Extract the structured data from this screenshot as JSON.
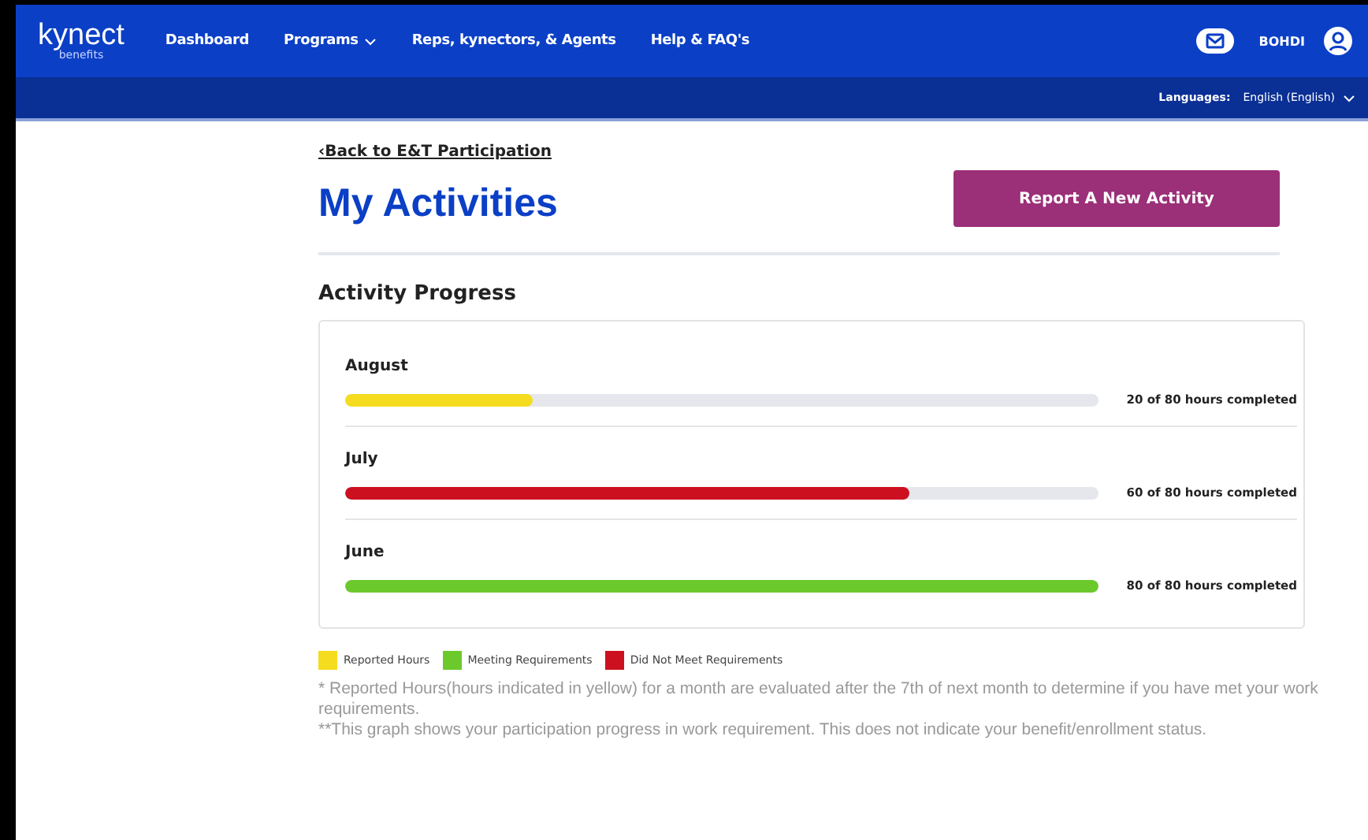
{
  "header": {
    "logo": "kynect",
    "logo_sub": "benefits",
    "nav": [
      {
        "label": "Dashboard",
        "dropdown": false
      },
      {
        "label": "Programs",
        "dropdown": true
      },
      {
        "label": "Reps, kynectors, & Agents",
        "dropdown": false
      },
      {
        "label": "Help & FAQ's",
        "dropdown": false
      }
    ],
    "user": "BOHDI",
    "languages_label": "Languages:",
    "language": "English (English)"
  },
  "back_link": "‹Back to E&T Participation",
  "title": "My Activities",
  "report_button": "Report A New Activity",
  "section_title": "Activity Progress",
  "months": [
    {
      "name": "August",
      "level": 0.25,
      "color": "#f5dc1e",
      "reading": "20 of 80 hours completed"
    },
    {
      "name": "July",
      "level": 0.75,
      "color": "#cc1020",
      "reading": "60 of 80 hours completed"
    },
    {
      "name": "June",
      "level": 1,
      "color": "#6cc92c",
      "reading": "80 of 80 hours completed"
    }
  ],
  "legend": [
    {
      "label": "Reported Hours",
      "color": "#f5dc1e"
    },
    {
      "label": "Meeting Requirements",
      "color": "#6cc92c"
    },
    {
      "label": "Did Not Meet Requirements",
      "color": "#cc1020"
    }
  ],
  "notes": [
    "* Reported Hours(hours indicated in yellow) for a month are evaluated after the 7th of next month to determine if you have met your work requirements.",
    "**This graph shows your participation progress in work requirement. This does not indicate your benefit/enrollment status."
  ]
}
